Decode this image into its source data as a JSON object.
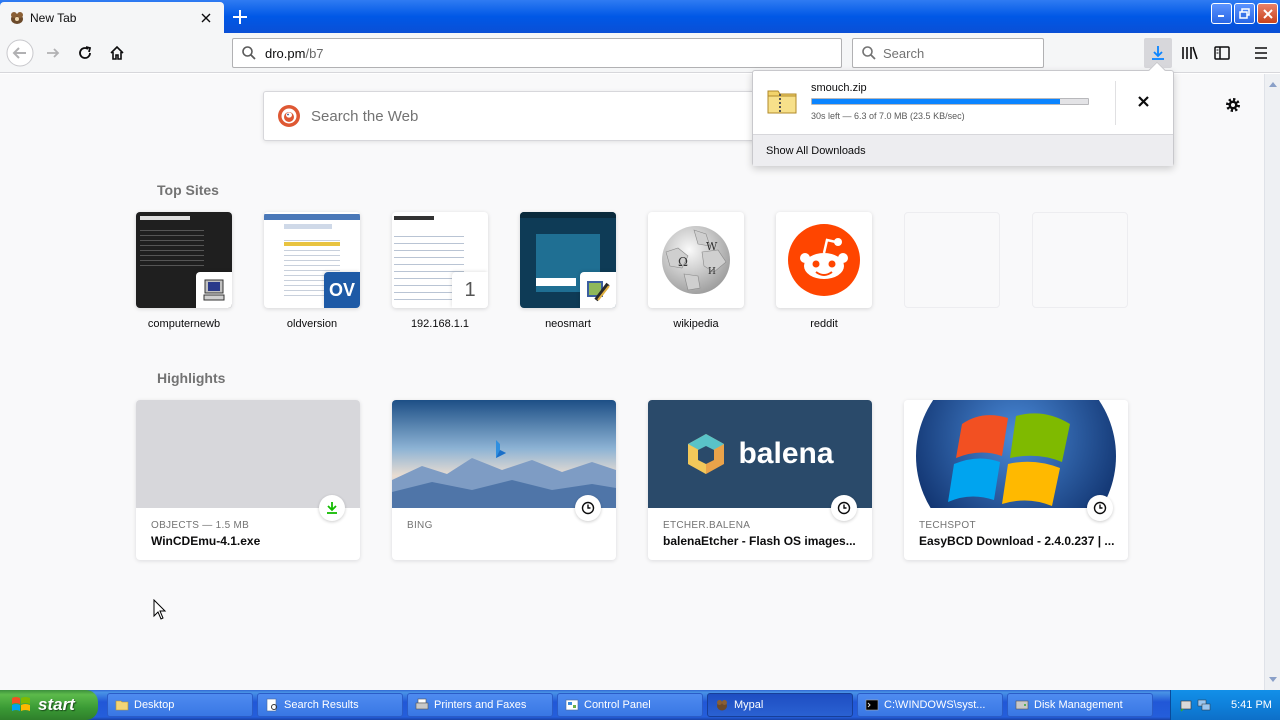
{
  "browser": {
    "tab_title": "New Tab",
    "url_host": "dro.pm",
    "url_path": "/b7",
    "search_placeholder": "Search"
  },
  "newtab": {
    "web_search_placeholder": "Search the Web",
    "top_sites_heading": "Top Sites",
    "highlights_heading": "Highlights",
    "top_sites": [
      {
        "label": "computernewb"
      },
      {
        "label": "oldversion",
        "badge_text": "OV"
      },
      {
        "label": "192.168.1.1",
        "badge_text": "1"
      },
      {
        "label": "neosmart"
      },
      {
        "label": "wikipedia"
      },
      {
        "label": "reddit"
      }
    ],
    "highlights": [
      {
        "source": "OBJECTS — 1.5 MB",
        "title": "WinCDEmu-4.1.exe",
        "action_icon": "download-icon"
      },
      {
        "source": "BING",
        "title": "",
        "action_icon": "clock-icon"
      },
      {
        "source": "ETCHER.BALENA",
        "title": "balenaEtcher - Flash OS images...",
        "brand": "balena",
        "action_icon": "clock-icon"
      },
      {
        "source": "TECHSPOT",
        "title": "EasyBCD Download - 2.4.0.237 | ...",
        "action_icon": "clock-icon"
      }
    ]
  },
  "downloads": {
    "filename": "smouch.zip",
    "status": "30s left — 6.3 of 7.0 MB (23.5 KB/sec)",
    "progress": 0.9,
    "show_all": "Show All Downloads"
  },
  "taskbar": {
    "start_label": "start",
    "items": [
      {
        "label": "Desktop"
      },
      {
        "label": "Search Results"
      },
      {
        "label": "Printers and Faxes"
      },
      {
        "label": "Control Panel"
      },
      {
        "label": "Mypal"
      },
      {
        "label": "C:\\WINDOWS\\syst..."
      },
      {
        "label": "Disk Management"
      }
    ],
    "clock": "5:41 PM"
  },
  "colors": {
    "accent": "#0a84ff",
    "xp_blue": "#0058e6",
    "start_green": "#3a9a35",
    "reddit": "#ff4500",
    "balena_bg": "#2a4a6a"
  }
}
